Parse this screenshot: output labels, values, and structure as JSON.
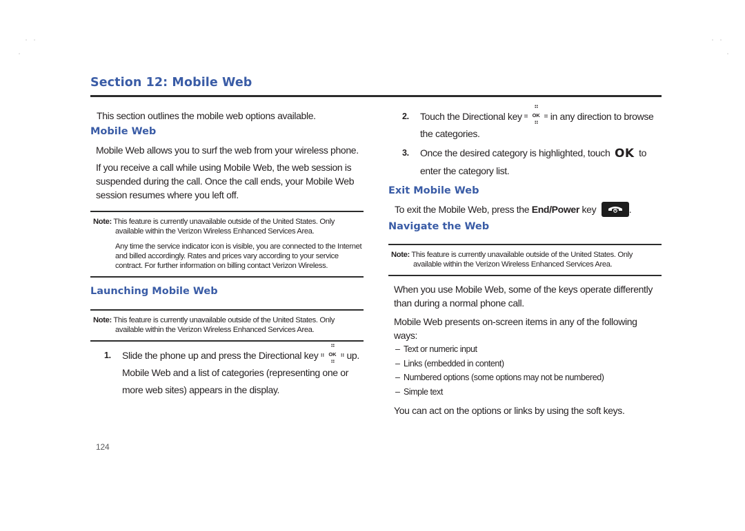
{
  "section_title": "Section 12: Mobile Web",
  "left_column": {
    "intro": "This section outlines the mobile web options available.",
    "mobile_web": {
      "heading": "Mobile Web",
      "paragraphs": [
        "Mobile Web allows you to surf the web from your wireless phone.",
        "If you receive a call while using Mobile Web, the web session is suspended during the call. Once the call ends, your Mobile Web session resumes where you left off."
      ]
    },
    "note_1": {
      "label": "Note:",
      "text": "This feature is currently unavailable outside of the United States. Only",
      "text_cont": "available within the Verizon Wireless Enhanced Services Area.",
      "extra": "Any time the service indicator icon is visible, you are connected to the Internet and billed accordingly. Rates and prices vary according to your service contract. For further information on billing contact Verizon Wireless."
    },
    "launching": {
      "heading": "Launching Mobile Web",
      "note": {
        "label": "Note:",
        "text": "This feature is currently unavailable outside of the United States. Only",
        "text_cont": "available within the Verizon Wireless Enhanced Services Area."
      },
      "step_1": {
        "number": "1.",
        "text_before_key": "Slide the phone up and press the Directional key",
        "key_label": "OK",
        "text_after_key": "up. Mobile Web and a list of categories (representing one or more web sites) appears in the display."
      }
    }
  },
  "right_column": {
    "step_2": {
      "number": "2.",
      "text_before_key": "Touch the Directional key",
      "key_label": "OK",
      "text_after_key": "in any direction to browse the categories."
    },
    "step_3": {
      "number": "3.",
      "text_before_key": "Once the desired category is highlighted, touch",
      "key_label": "OK",
      "text_after_key": "to enter the category list."
    },
    "exit": {
      "heading": "Exit Mobile Web",
      "text_before": "To exit the Mobile Web, press the",
      "key_name": "End/Power",
      "text_after": "key",
      "end_punct": "."
    },
    "navigate": {
      "heading": "Navigate the Web",
      "note": {
        "label": "Note:",
        "text": "This feature is currently unavailable outside of the United States. Only",
        "text_cont": "available within the Verizon Wireless Enhanced Services Area."
      },
      "paragraphs": [
        "When you use Mobile Web, some of the keys operate differently than during a normal phone call.",
        "Mobile Web presents on-screen items in any of the following ways:"
      ],
      "bullets": [
        "Text or numeric input",
        "Links (embedded in content)",
        "Numbered options (some options may not be numbered)",
        "Simple text"
      ],
      "closing": "You can act on the options or links by using the soft keys."
    }
  },
  "page_number": "124",
  "colors": {
    "heading_blue": "#3a5ca6",
    "body_text": "#231f20",
    "rule": "#2b2b2b"
  }
}
